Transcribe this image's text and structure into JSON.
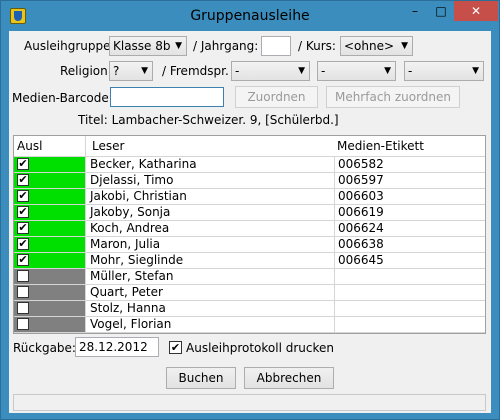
{
  "window": {
    "title": "Gruppenausleihe",
    "min": "–",
    "max": "□",
    "close": "✕"
  },
  "form": {
    "ausleihgruppe_label": "Ausleihgruppe:",
    "ausleihgruppe_value": "Klasse 8b",
    "jahrgang_label": "/ Jahrgang:",
    "jahrgang_value": "",
    "kurs_label": "/ Kurs:",
    "kurs_value": "<ohne>",
    "religion_label": "Religion:",
    "religion_value": "?",
    "fremdspr_label": "/ Fremdspr.",
    "fremdspr_values": [
      "-",
      "-",
      "-"
    ],
    "barcode_label": "Medien-Barcode:",
    "barcode_value": "",
    "zuordnen_label": "Zuordnen",
    "mehrfach_label": "Mehrfach zuordnen",
    "titel_text": "Titel: Lambacher-Schweizer. 9, [Schülerbd.]"
  },
  "grid": {
    "headers": {
      "ausl": "Ausl",
      "leser": "Leser",
      "etikett": "Medien-Etikett"
    },
    "rows": [
      {
        "checked": true,
        "leser": "Becker, Katharina",
        "etikett": "006582",
        "status_color": "#00e000"
      },
      {
        "checked": true,
        "leser": "Djelassi, Timo",
        "etikett": "006597",
        "status_color": "#00e000"
      },
      {
        "checked": true,
        "leser": "Jakobi, Christian",
        "etikett": "006603",
        "status_color": "#00e000"
      },
      {
        "checked": true,
        "leser": "Jakoby, Sonja",
        "etikett": "006619",
        "status_color": "#00e000"
      },
      {
        "checked": true,
        "leser": "Koch, Andrea",
        "etikett": "006624",
        "status_color": "#00e000"
      },
      {
        "checked": true,
        "leser": "Maron, Julia",
        "etikett": "006638",
        "status_color": "#00e000"
      },
      {
        "checked": true,
        "leser": "Mohr, Sieglinde",
        "etikett": "006645",
        "status_color": "#00e000"
      },
      {
        "checked": false,
        "leser": "Müller, Stefan",
        "etikett": "",
        "status_color": "#808080"
      },
      {
        "checked": false,
        "leser": "Quart, Peter",
        "etikett": "",
        "status_color": "#808080"
      },
      {
        "checked": false,
        "leser": "Stolz, Hanna",
        "etikett": "",
        "status_color": "#808080"
      },
      {
        "checked": false,
        "leser": "Vogel, Florian",
        "etikett": "",
        "status_color": "#808080"
      }
    ]
  },
  "footer": {
    "rueckgabe_label": "Rückgabe:",
    "rueckgabe_value": "28.12.2012",
    "protokoll_checked": true,
    "protokoll_label": "Ausleihprotokoll drucken",
    "buchen_label": "Buchen",
    "abbrechen_label": "Abbrechen"
  }
}
